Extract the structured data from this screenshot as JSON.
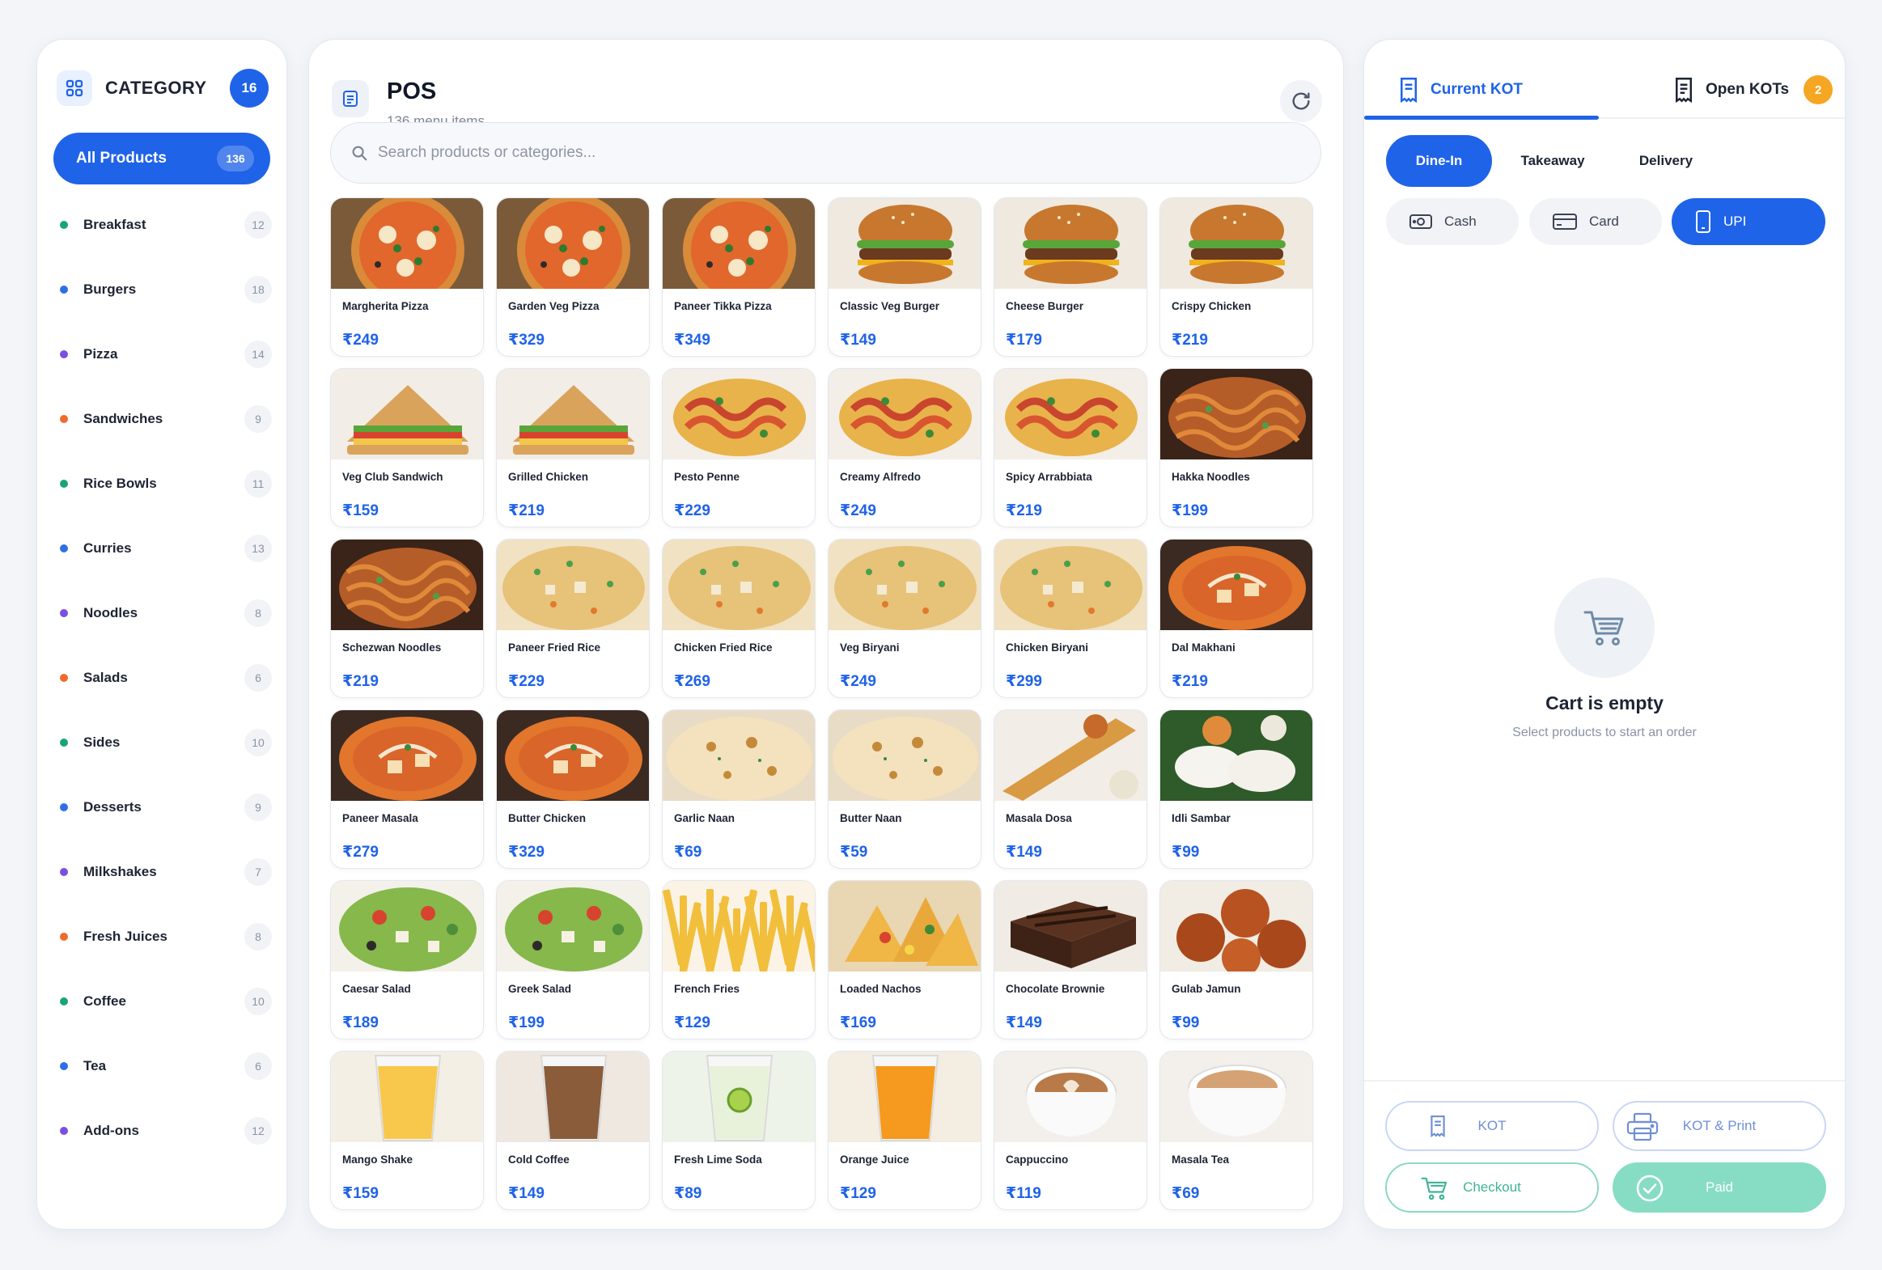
{
  "sidebar": {
    "title": "CATEGORY",
    "count": "16",
    "all_products": {
      "label": "All Products",
      "count": "136"
    },
    "items": [
      {
        "label": "Breakfast",
        "count": "12",
        "color": "#1aa37a"
      },
      {
        "label": "Burgers",
        "count": "18",
        "color": "#2f6fe6"
      },
      {
        "label": "Pizza",
        "count": "14",
        "color": "#7b4fe0"
      },
      {
        "label": "Sandwiches",
        "count": "9",
        "color": "#f06a2a"
      },
      {
        "label": "Rice Bowls",
        "count": "11",
        "color": "#1aa37a"
      },
      {
        "label": "Curries",
        "count": "13",
        "color": "#2f6fe6"
      },
      {
        "label": "Noodles",
        "count": "8",
        "color": "#7b4fe0"
      },
      {
        "label": "Salads",
        "count": "6",
        "color": "#f06a2a"
      },
      {
        "label": "Sides",
        "count": "10",
        "color": "#1aa37a"
      },
      {
        "label": "Desserts",
        "count": "9",
        "color": "#2f6fe6"
      },
      {
        "label": "Milkshakes",
        "count": "7",
        "color": "#7b4fe0"
      },
      {
        "label": "Fresh Juices",
        "count": "8",
        "color": "#f06a2a"
      },
      {
        "label": "Coffee",
        "count": "10",
        "color": "#1aa37a"
      },
      {
        "label": "Tea",
        "count": "6",
        "color": "#2f6fe6"
      },
      {
        "label": "Add-ons",
        "count": "12",
        "color": "#7b4fe0"
      }
    ]
  },
  "pos": {
    "title": "POS",
    "subtitle": "136 menu items",
    "search_placeholder": "Search products or categories...",
    "products": [
      {
        "name": "Margherita Pizza",
        "price": "₹249",
        "icon": "pizza"
      },
      {
        "name": "Garden Veg Pizza",
        "price": "₹329",
        "icon": "pizza"
      },
      {
        "name": "Paneer Tikka Pizza",
        "price": "₹349",
        "icon": "pizza"
      },
      {
        "name": "Classic Veg Burger",
        "price": "₹149",
        "icon": "burger"
      },
      {
        "name": "Cheese Burger",
        "price": "₹179",
        "icon": "burger"
      },
      {
        "name": "Crispy Chicken",
        "price": "₹219",
        "icon": "burger"
      },
      {
        "name": "Veg Club Sandwich",
        "price": "₹159",
        "icon": "sandwich"
      },
      {
        "name": "Grilled Chicken",
        "price": "₹219",
        "icon": "sandwich"
      },
      {
        "name": "Pesto Penne",
        "price": "₹229",
        "icon": "pasta"
      },
      {
        "name": "Creamy Alfredo",
        "price": "₹249",
        "icon": "pasta"
      },
      {
        "name": "Spicy Arrabbiata",
        "price": "₹219",
        "icon": "pasta"
      },
      {
        "name": "Hakka Noodles",
        "price": "₹199",
        "icon": "noodles"
      },
      {
        "name": "Schezwan Noodles",
        "price": "₹219",
        "icon": "noodles"
      },
      {
        "name": "Paneer Fried Rice",
        "price": "₹229",
        "icon": "rice"
      },
      {
        "name": "Chicken Fried Rice",
        "price": "₹269",
        "icon": "rice"
      },
      {
        "name": "Veg Biryani",
        "price": "₹249",
        "icon": "rice"
      },
      {
        "name": "Chicken Biryani",
        "price": "₹299",
        "icon": "rice"
      },
      {
        "name": "Dal Makhani",
        "price": "₹219",
        "icon": "curry"
      },
      {
        "name": "Paneer Masala",
        "price": "₹279",
        "icon": "curry"
      },
      {
        "name": "Butter Chicken",
        "price": "₹329",
        "icon": "curry"
      },
      {
        "name": "Garlic Naan",
        "price": "₹69",
        "icon": "naan"
      },
      {
        "name": "Butter Naan",
        "price": "₹59",
        "icon": "naan"
      },
      {
        "name": "Masala Dosa",
        "price": "₹149",
        "icon": "dosa"
      },
      {
        "name": "Idli Sambar",
        "price": "₹99",
        "icon": "idli"
      },
      {
        "name": "Caesar Salad",
        "price": "₹189",
        "icon": "salad"
      },
      {
        "name": "Greek Salad",
        "price": "₹199",
        "icon": "salad"
      },
      {
        "name": "French Fries",
        "price": "₹129",
        "icon": "fries"
      },
      {
        "name": "Loaded Nachos",
        "price": "₹169",
        "icon": "nachos"
      },
      {
        "name": "Chocolate Brownie",
        "price": "₹149",
        "icon": "brownie"
      },
      {
        "name": "Gulab Jamun",
        "price": "₹99",
        "icon": "jamun"
      },
      {
        "name": "Mango Shake",
        "price": "₹159",
        "icon": "drink-mango"
      },
      {
        "name": "Cold Coffee",
        "price": "₹149",
        "icon": "drink-coffee"
      },
      {
        "name": "Fresh Lime Soda",
        "price": "₹89",
        "icon": "drink-lime"
      },
      {
        "name": "Orange Juice",
        "price": "₹129",
        "icon": "drink-orange"
      },
      {
        "name": "Cappuccino",
        "price": "₹119",
        "icon": "cup-coffee"
      },
      {
        "name": "Masala Tea",
        "price": "₹69",
        "icon": "cup-tea"
      }
    ]
  },
  "kot": {
    "tabs": {
      "current": "Current KOT",
      "open": "Open KOTs",
      "open_count": "2"
    },
    "order_types": {
      "dine_in": "Dine-In",
      "takeaway": "Takeaway",
      "delivery": "Delivery"
    },
    "payments": {
      "cash": "Cash",
      "card": "Card",
      "upi": "UPI"
    },
    "empty": {
      "title": "Cart is empty",
      "subtitle": "Select products to start an order"
    },
    "buttons": {
      "kot": "KOT",
      "kot_print": "KOT & Print",
      "checkout": "Checkout",
      "paid": "Paid"
    }
  },
  "colors": {
    "accent": "#1f63e8",
    "success": "#40b495",
    "warning": "#f5a623"
  }
}
